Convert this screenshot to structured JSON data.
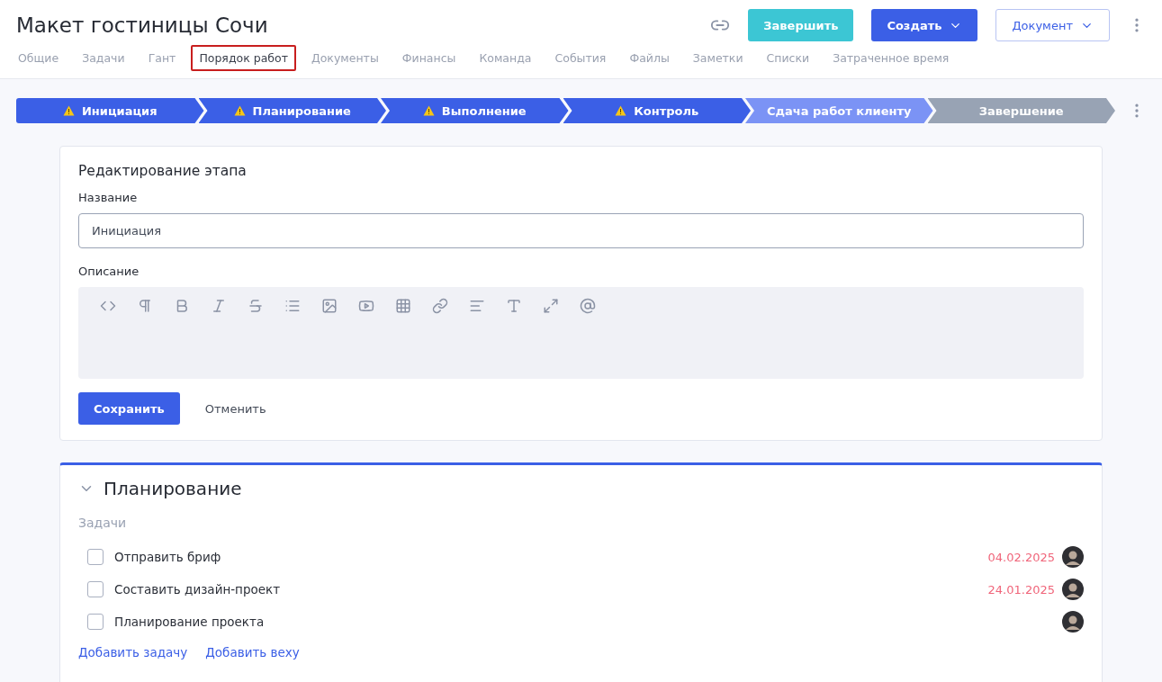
{
  "project": {
    "title": "Макет гостиницы Сочи"
  },
  "header_buttons": [
    {
      "kind": "finish",
      "label": "Завершить"
    },
    {
      "kind": "create",
      "label": "Создать"
    },
    {
      "kind": "document",
      "label": "Документ"
    }
  ],
  "tabs": [
    {
      "label": "Общие",
      "selected": false
    },
    {
      "label": "Задачи",
      "selected": false
    },
    {
      "label": "Гант",
      "selected": false
    },
    {
      "label": "Порядок работ",
      "selected": true
    },
    {
      "label": "Документы",
      "selected": false
    },
    {
      "label": "Финансы",
      "selected": false
    },
    {
      "label": "Команда",
      "selected": false
    },
    {
      "label": "События",
      "selected": false
    },
    {
      "label": "Файлы",
      "selected": false
    },
    {
      "label": "Заметки",
      "selected": false
    },
    {
      "label": "Списки",
      "selected": false
    },
    {
      "label": "Затраченное время",
      "selected": false
    }
  ],
  "stages": [
    {
      "label": "Инициация",
      "kind": "done",
      "warning": true
    },
    {
      "label": "Планирование",
      "kind": "done",
      "warning": true
    },
    {
      "label": "Выполнение",
      "kind": "done",
      "warning": true
    },
    {
      "label": "Контроль",
      "kind": "done",
      "warning": true
    },
    {
      "label": "Сдача работ клиенту",
      "kind": "current",
      "warning": false
    },
    {
      "label": "Завершение",
      "kind": "pending",
      "warning": false
    }
  ],
  "edit_stage": {
    "heading": "Редактирование этапа",
    "name_label": "Название",
    "name_value": "Инициация",
    "description_label": "Описание",
    "save": "Сохранить",
    "cancel": "Отменить"
  },
  "section": {
    "title": "Планирование",
    "expanded": true,
    "tasks_label": "Задачи",
    "tasks": [
      {
        "title": "Отправить бриф",
        "checked": false,
        "date": "04.02.2025"
      },
      {
        "title": "Составить дизайн-проект",
        "checked": false,
        "date": "24.01.2025"
      },
      {
        "title": "Планирование проекта",
        "checked": false
      }
    ],
    "links": [
      "Добавить задачу",
      "Добавить веху"
    ]
  }
}
